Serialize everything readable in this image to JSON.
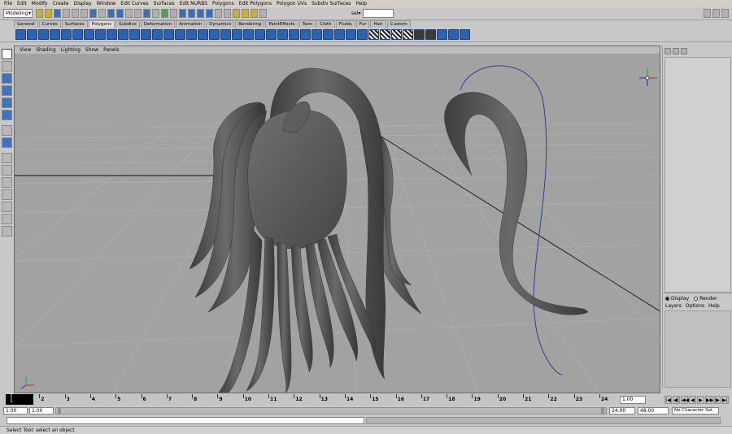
{
  "menus": [
    "File",
    "Edit",
    "Modify",
    "Create",
    "Display",
    "Window",
    "Edit Curves",
    "Surfaces",
    "Edit NURBS",
    "Polygons",
    "Edit Polygons",
    "Polygon UVs",
    "Subdiv Surfaces",
    "Help"
  ],
  "status_line": {
    "mode": "Modeling",
    "sel_label": "sel▾"
  },
  "shelf_tabs": [
    "General",
    "Curves",
    "Surfaces",
    "Polygons",
    "Subdivs",
    "Deformation",
    "Animation",
    "Dynamics",
    "Rendering",
    "PaintEffects",
    "Toon",
    "Cloth",
    "Fluids",
    "Fur",
    "Hair",
    "Custom"
  ],
  "active_shelf_tab": "Polygons",
  "panel_menu": [
    "View",
    "Shading",
    "Lighting",
    "Show",
    "Panels"
  ],
  "layer_editor": {
    "display_label": "Display",
    "render_label": "Render",
    "menu": [
      "Layers",
      "Options",
      "Help"
    ]
  },
  "time_slider": {
    "current_frame": "1",
    "current_frame_sub": "1",
    "ticks": [
      "1",
      "2",
      "3",
      "4",
      "5",
      "6",
      "7",
      "8",
      "9",
      "10",
      "11",
      "12",
      "13",
      "14",
      "15",
      "16",
      "17",
      "18",
      "19",
      "20",
      "21",
      "22",
      "23",
      "24"
    ],
    "current_time_field": "1.00",
    "playback_buttons": [
      "|◀",
      "◀|",
      "◀◀",
      "◀",
      "▶",
      "▶▶",
      "|▶",
      "▶|"
    ]
  },
  "range_slider": {
    "start": "1.00",
    "inner_start": "1.00",
    "inner_end": "24.00",
    "end": "48.00",
    "character_set": "No Character Set"
  },
  "command_line": {
    "label": ""
  },
  "help_line": "Select Tool: select an object",
  "colors": {
    "viewport_bg": "#a2a2a2",
    "grid": "#b6b6b6",
    "hair_mesh": "#5a5a5a",
    "curve": "#2c3fa0",
    "shelf_icon": "#2b63b0"
  }
}
